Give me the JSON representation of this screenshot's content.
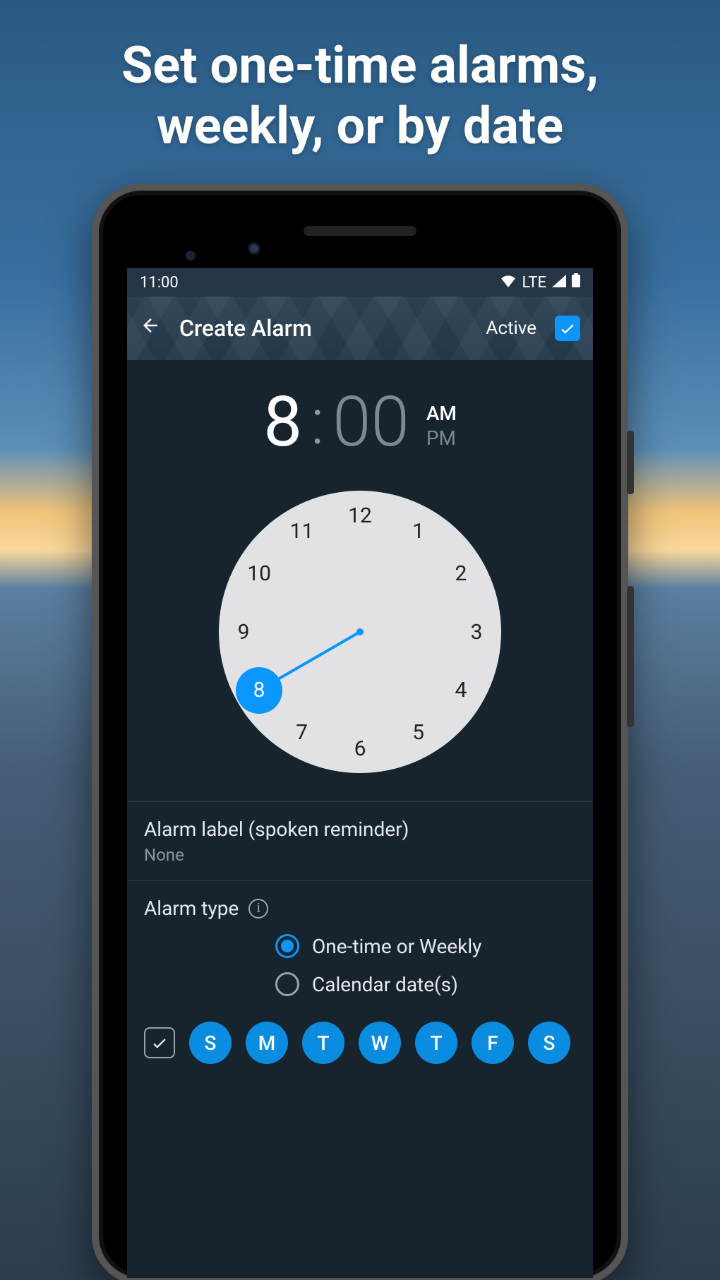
{
  "marketing": {
    "headline_l1": "Set one-time alarms,",
    "headline_l2": "weekly, or by date"
  },
  "statusbar": {
    "time": "11:00",
    "network": "LTE"
  },
  "appbar": {
    "title": "Create Alarm",
    "active_label": "Active",
    "active_checked": true
  },
  "time": {
    "hour": "8",
    "separator": ":",
    "minute": "00",
    "am": "AM",
    "pm": "PM",
    "period_selected": "AM"
  },
  "clock": {
    "selected_hour": 8,
    "numbers": [
      12,
      1,
      2,
      3,
      4,
      5,
      6,
      7,
      8,
      9,
      10,
      11
    ]
  },
  "label_row": {
    "title": "Alarm label (spoken reminder)",
    "value": "None"
  },
  "type": {
    "title": "Alarm type",
    "options": [
      {
        "label": "One-time or Weekly",
        "selected": true
      },
      {
        "label": "Calendar date(s)",
        "selected": false
      }
    ]
  },
  "days": {
    "all_checked": true,
    "items": [
      "S",
      "M",
      "T",
      "W",
      "T",
      "F",
      "S"
    ]
  }
}
